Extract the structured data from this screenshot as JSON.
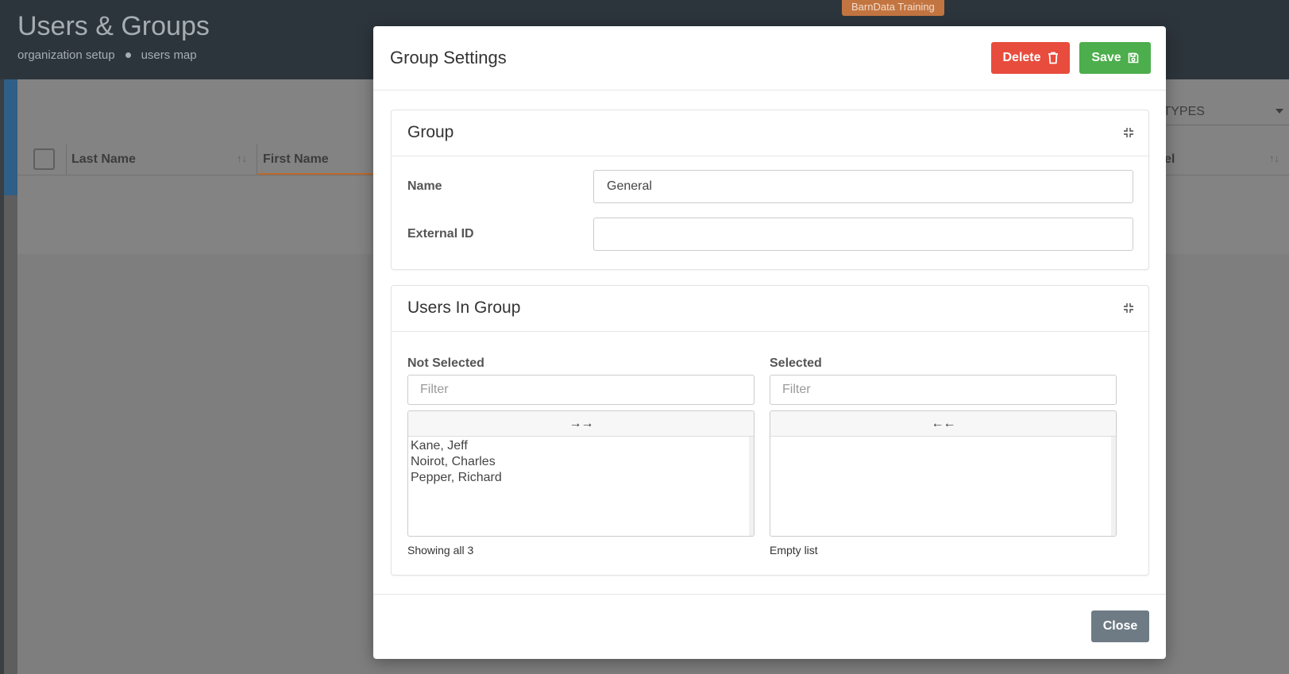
{
  "page": {
    "title": "Users & Groups",
    "breadcrumbs": [
      "organization setup",
      "users map"
    ],
    "env_badge": "BarnData Training"
  },
  "background_table": {
    "columns": [
      "Last Name",
      "First Name",
      "el"
    ],
    "type_filter": "L TYPES"
  },
  "modal": {
    "title": "Group Settings",
    "delete_label": "Delete",
    "save_label": "Save",
    "close_label": "Close",
    "colors": {
      "delete": "#e84c3d",
      "save": "#4cae4c",
      "close": "#6e7b85"
    },
    "group_card": {
      "title": "Group",
      "name_label": "Name",
      "name_value": "General",
      "external_id_label": "External ID",
      "external_id_value": ""
    },
    "users_card": {
      "title": "Users In Group",
      "not_selected": {
        "label": "Not Selected",
        "filter_placeholder": "Filter",
        "move_label": "→→",
        "items": [
          "Kane, Jeff",
          "Noirot, Charles",
          "Pepper, Richard"
        ],
        "footer": "Showing all 3"
      },
      "selected": {
        "label": "Selected",
        "filter_placeholder": "Filter",
        "move_label": "←←",
        "items": [],
        "footer": "Empty list"
      }
    }
  }
}
